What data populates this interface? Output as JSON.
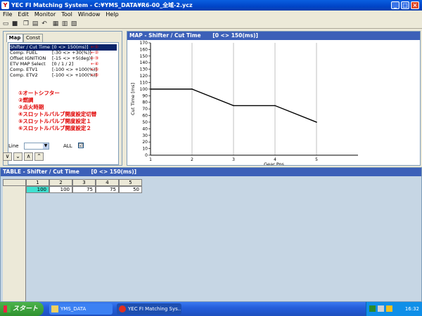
{
  "window": {
    "title": "YEC FI Matching System - C:¥YMS_DATA¥R6-00_全域-2.ycz",
    "minimize": "_",
    "maximize": "□",
    "close": "×"
  },
  "menu": [
    "File",
    "Edit",
    "Monitor",
    "Tool",
    "Window",
    "Help"
  ],
  "tabs": {
    "map": "Map",
    "const": "Const"
  },
  "params": [
    {
      "name": "Shifter / Cut Time",
      "value": "[0 <> 150(ms)]",
      "mark": "←①"
    },
    {
      "name": "Comp. FUEL",
      "value": "[-30 <> +30(%)]",
      "mark": "←②"
    },
    {
      "name": "Offset IGNITION",
      "value": "[-15 <> +5(deg)]",
      "mark": "←③"
    },
    {
      "name": "ETV MAP Select",
      "value": "[0 / 1 / 2]",
      "mark": "←④"
    },
    {
      "name": "Comp. ETV1",
      "value": "[-100 <> +100(%)]",
      "mark": "←⑤"
    },
    {
      "name": "Comp. ETV2",
      "value": "[-100 <> +100(%)]",
      "mark": "←⑥"
    }
  ],
  "notes": [
    "①オートシフター",
    "②燃調",
    "③点火時期",
    "④スロットルバルブ開度設定切替",
    "⑤スロットルバルブ開度設定１",
    "⑥スロットルバルブ開度設定２"
  ],
  "controls": {
    "line_label": "Line",
    "line_value": "",
    "all_label": "ALL",
    "all_checked": "☑"
  },
  "map_window": {
    "title": "MAP - Shifter / Cut Time",
    "range": "[0 <> 150(ms)]"
  },
  "chart_data": {
    "type": "line",
    "x": [
      1,
      2,
      3,
      4,
      5
    ],
    "values": [
      100,
      100,
      75,
      75,
      50
    ],
    "xlabel": "Gear Pos",
    "ylabel": "Cut Time [ms]",
    "xlim": [
      1,
      6
    ],
    "ylim": [
      0,
      170
    ],
    "yticks": [
      0,
      10,
      20,
      30,
      40,
      50,
      60,
      70,
      80,
      90,
      100,
      110,
      120,
      130,
      140,
      150,
      160,
      170
    ],
    "xticks": [
      1,
      2,
      3,
      4,
      5
    ],
    "grid": "vertical"
  },
  "table_window": {
    "title": "TABLE - Shifter / Cut Time",
    "range": "[0 <> 150(ms)]",
    "headers": [
      "1",
      "2",
      "3",
      "4",
      "5"
    ],
    "values": [
      "100",
      "100",
      "75",
      "75",
      "50"
    ]
  },
  "taskbar": {
    "start": "スタート",
    "items": [
      "YMS_DATA",
      "YEC FI Matching Sys..."
    ],
    "clock": "16:32"
  },
  "colors": {
    "title_blue": "#0a5fe0",
    "annotation_red": "#e00000",
    "selection_blue": "#0a246a",
    "table_bg": "#c6d6e4",
    "selected_cell": "#40e0d0"
  }
}
